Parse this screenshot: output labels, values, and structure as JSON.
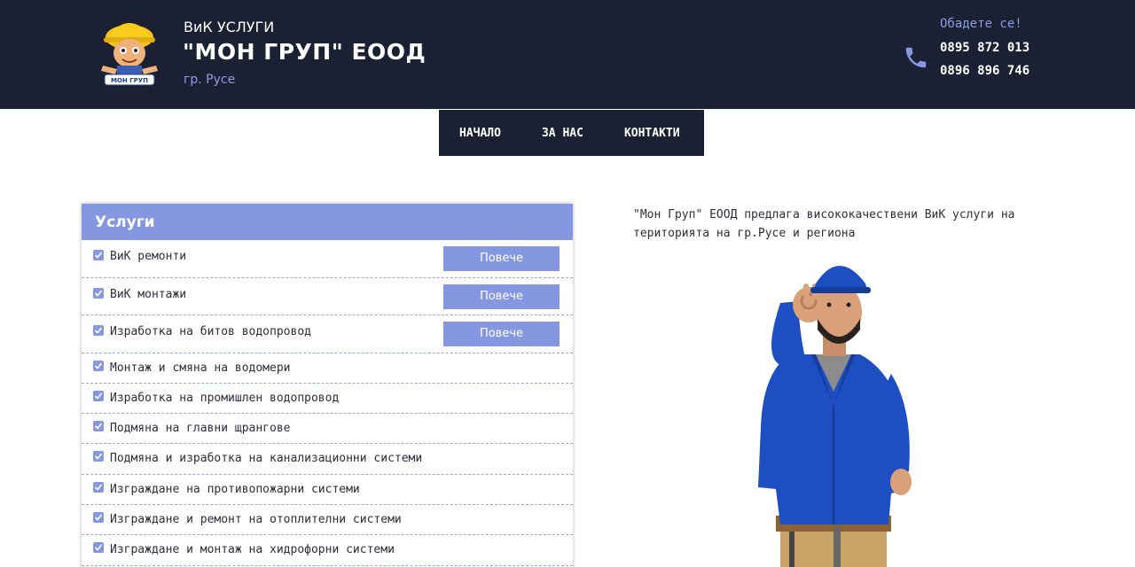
{
  "header": {
    "subtitle": "ВиК УСЛУГИ",
    "company": "\"МОН ГРУП\" ЕООД",
    "city": "гр. Русе",
    "logo_text": "МОН ГРУП",
    "call_label": "Обадете се!",
    "phones": [
      "0895 872 013",
      "0896 896 746"
    ],
    "icons": {
      "logo": "worker-mascot-logo",
      "phone": "phone-icon"
    }
  },
  "nav": {
    "items": [
      {
        "label": "НАЧАЛО"
      },
      {
        "label": "ЗА НАС"
      },
      {
        "label": "КОНТАКТИ"
      }
    ]
  },
  "services": {
    "title": "Услуги",
    "more_label": "Повече",
    "items": [
      {
        "label": "ВиК ремонти"
      },
      {
        "label": "ВиК монтажи"
      },
      {
        "label": "Изработка на битов водопровод"
      },
      {
        "label": "Монтаж и смяна на водомери"
      },
      {
        "label": "Изработка на промишлен водопровод"
      },
      {
        "label": "Подмяна на главни щрангове"
      },
      {
        "label": "Подмяна и изработка на канализационни системи"
      },
      {
        "label": "Изграждане на противопожарни системи"
      },
      {
        "label": "Изграждане и ремонт на отоплителни системи"
      },
      {
        "label": "Изграждане и монтаж на хидрофорни системи"
      }
    ]
  },
  "intro": {
    "text": "\"Мон Груп\" ЕООД предлага висококачествени ВиК услуги на територията на гр.Русе и региона"
  },
  "colors": {
    "header_bg": "#1b2032",
    "accent": "#8497e0",
    "text": "#2b2f3a"
  }
}
